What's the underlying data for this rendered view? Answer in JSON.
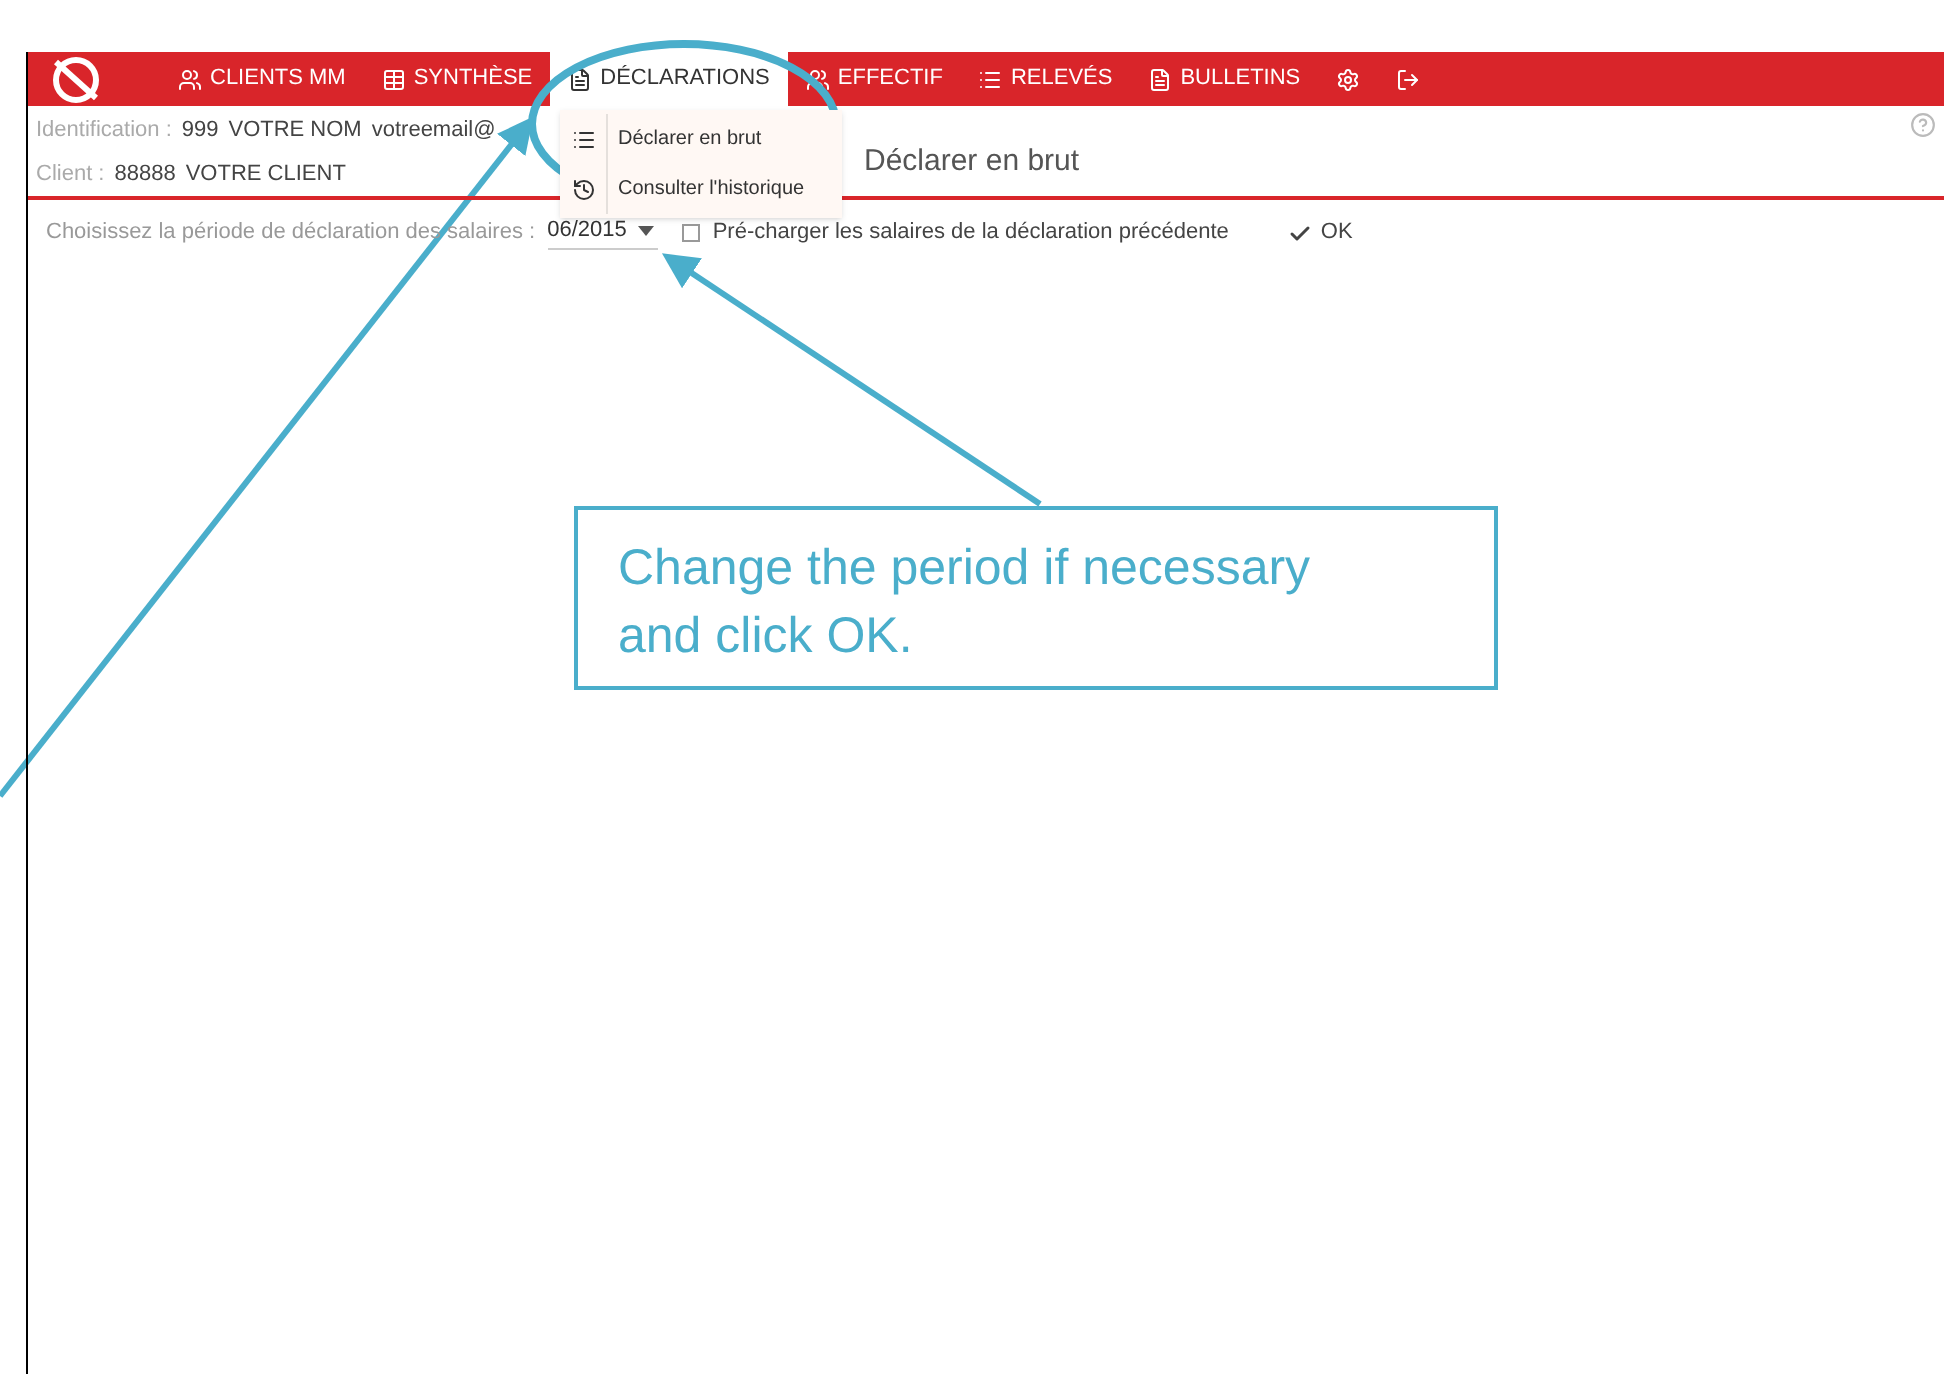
{
  "nav": {
    "items": [
      {
        "label": "CLIENTS MM",
        "selected": false
      },
      {
        "label": "SYNTHÈSE",
        "selected": false
      },
      {
        "label": "DÉCLARATIONS",
        "selected": true
      },
      {
        "label": "EFFECTIF",
        "selected": false
      },
      {
        "label": "RELEVÉS",
        "selected": false
      },
      {
        "label": "BULLETINS",
        "selected": false
      },
      {
        "selected": false
      },
      {
        "selected": false
      }
    ]
  },
  "dropdown": {
    "items": [
      {
        "label": "Déclarer en brut"
      },
      {
        "label": "Consulter l'historique"
      }
    ]
  },
  "info": {
    "identification_label": "Identification :",
    "identification_number": "999",
    "name": "VOTRE NOM",
    "email": "votreemail@",
    "client_label": "Client :",
    "client_number": "88888",
    "client_name": "VOTRE CLIENT"
  },
  "page_title": "Déclarer en brut",
  "form": {
    "period_label": "Choisissez la période de déclaration des salaires :",
    "period_value": "06/2015",
    "preload_label": "Pré-charger les salaires de la déclaration précédente",
    "preload_checked": false,
    "ok_label": "OK"
  },
  "callout": {
    "text": "Change the period if necessary and click OK."
  }
}
